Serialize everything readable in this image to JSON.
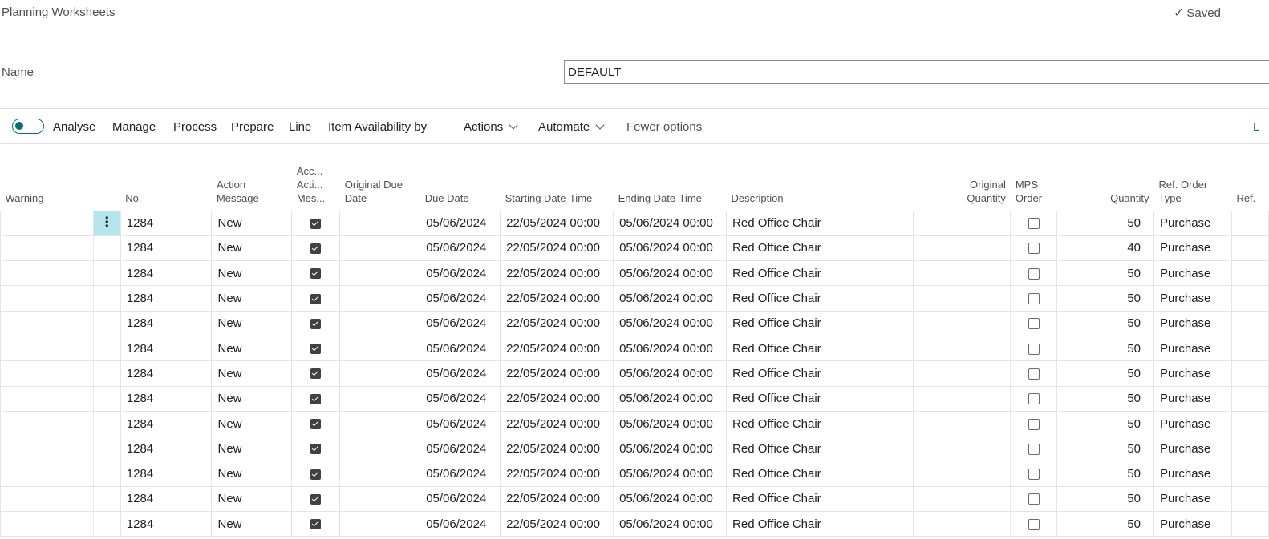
{
  "page": {
    "title": "Planning Worksheets",
    "saved_label": "Saved"
  },
  "name_field": {
    "label": "Name",
    "value": "DEFAULT"
  },
  "toolbar": {
    "analyse_toggle_on": true,
    "analyse": "Analyse",
    "manage": "Manage",
    "process": "Process",
    "prepare": "Prepare",
    "line": "Line",
    "item_availability": "Item Availability by",
    "actions": "Actions",
    "automate": "Automate",
    "fewer_options": "Fewer options",
    "edge_text": "L"
  },
  "columns": {
    "warning": "Warning",
    "no": "No.",
    "action_message_1": "Action",
    "action_message_2": "Message",
    "accept_1": "Acc...",
    "accept_2": "Acti...",
    "accept_3": "Mes...",
    "orig_due_1": "Original Due",
    "orig_due_2": "Date",
    "due_date": "Due Date",
    "starting": "Starting Date-Time",
    "ending": "Ending Date-Time",
    "description": "Description",
    "orig_qty_1": "Original",
    "orig_qty_2": "Quantity",
    "mps_1": "MPS",
    "mps_2": "Order",
    "quantity": "Quantity",
    "ref_type_1": "Ref. Order",
    "ref_type_2": "Type",
    "ref_no": "Ref."
  },
  "rows": [
    {
      "no": "1284",
      "action": "New",
      "accept": true,
      "orig_due": "",
      "due": "05/06/2024",
      "start": "22/05/2024 00:00",
      "end": "05/06/2024 00:00",
      "desc": "Red Office Chair",
      "orig_qty": "",
      "mps": false,
      "qty": "50",
      "ref_type": "Purchase"
    },
    {
      "no": "1284",
      "action": "New",
      "accept": true,
      "orig_due": "",
      "due": "05/06/2024",
      "start": "22/05/2024 00:00",
      "end": "05/06/2024 00:00",
      "desc": "Red Office Chair",
      "orig_qty": "",
      "mps": false,
      "qty": "40",
      "ref_type": "Purchase"
    },
    {
      "no": "1284",
      "action": "New",
      "accept": true,
      "orig_due": "",
      "due": "05/06/2024",
      "start": "22/05/2024 00:00",
      "end": "05/06/2024 00:00",
      "desc": "Red Office Chair",
      "orig_qty": "",
      "mps": false,
      "qty": "50",
      "ref_type": "Purchase"
    },
    {
      "no": "1284",
      "action": "New",
      "accept": true,
      "orig_due": "",
      "due": "05/06/2024",
      "start": "22/05/2024 00:00",
      "end": "05/06/2024 00:00",
      "desc": "Red Office Chair",
      "orig_qty": "",
      "mps": false,
      "qty": "50",
      "ref_type": "Purchase"
    },
    {
      "no": "1284",
      "action": "New",
      "accept": true,
      "orig_due": "",
      "due": "05/06/2024",
      "start": "22/05/2024 00:00",
      "end": "05/06/2024 00:00",
      "desc": "Red Office Chair",
      "orig_qty": "",
      "mps": false,
      "qty": "50",
      "ref_type": "Purchase"
    },
    {
      "no": "1284",
      "action": "New",
      "accept": true,
      "orig_due": "",
      "due": "05/06/2024",
      "start": "22/05/2024 00:00",
      "end": "05/06/2024 00:00",
      "desc": "Red Office Chair",
      "orig_qty": "",
      "mps": false,
      "qty": "50",
      "ref_type": "Purchase"
    },
    {
      "no": "1284",
      "action": "New",
      "accept": true,
      "orig_due": "",
      "due": "05/06/2024",
      "start": "22/05/2024 00:00",
      "end": "05/06/2024 00:00",
      "desc": "Red Office Chair",
      "orig_qty": "",
      "mps": false,
      "qty": "50",
      "ref_type": "Purchase"
    },
    {
      "no": "1284",
      "action": "New",
      "accept": true,
      "orig_due": "",
      "due": "05/06/2024",
      "start": "22/05/2024 00:00",
      "end": "05/06/2024 00:00",
      "desc": "Red Office Chair",
      "orig_qty": "",
      "mps": false,
      "qty": "50",
      "ref_type": "Purchase"
    },
    {
      "no": "1284",
      "action": "New",
      "accept": true,
      "orig_due": "",
      "due": "05/06/2024",
      "start": "22/05/2024 00:00",
      "end": "05/06/2024 00:00",
      "desc": "Red Office Chair",
      "orig_qty": "",
      "mps": false,
      "qty": "50",
      "ref_type": "Purchase"
    },
    {
      "no": "1284",
      "action": "New",
      "accept": true,
      "orig_due": "",
      "due": "05/06/2024",
      "start": "22/05/2024 00:00",
      "end": "05/06/2024 00:00",
      "desc": "Red Office Chair",
      "orig_qty": "",
      "mps": false,
      "qty": "50",
      "ref_type": "Purchase"
    },
    {
      "no": "1284",
      "action": "New",
      "accept": true,
      "orig_due": "",
      "due": "05/06/2024",
      "start": "22/05/2024 00:00",
      "end": "05/06/2024 00:00",
      "desc": "Red Office Chair",
      "orig_qty": "",
      "mps": false,
      "qty": "50",
      "ref_type": "Purchase"
    },
    {
      "no": "1284",
      "action": "New",
      "accept": true,
      "orig_due": "",
      "due": "05/06/2024",
      "start": "22/05/2024 00:00",
      "end": "05/06/2024 00:00",
      "desc": "Red Office Chair",
      "orig_qty": "",
      "mps": false,
      "qty": "50",
      "ref_type": "Purchase"
    },
    {
      "no": "1284",
      "action": "New",
      "accept": true,
      "orig_due": "",
      "due": "05/06/2024",
      "start": "22/05/2024 00:00",
      "end": "05/06/2024 00:00",
      "desc": "Red Office Chair",
      "orig_qty": "",
      "mps": false,
      "qty": "50",
      "ref_type": "Purchase"
    }
  ],
  "colors": {
    "accent": "#00707a",
    "selected_cell": "#b3e5ec"
  }
}
